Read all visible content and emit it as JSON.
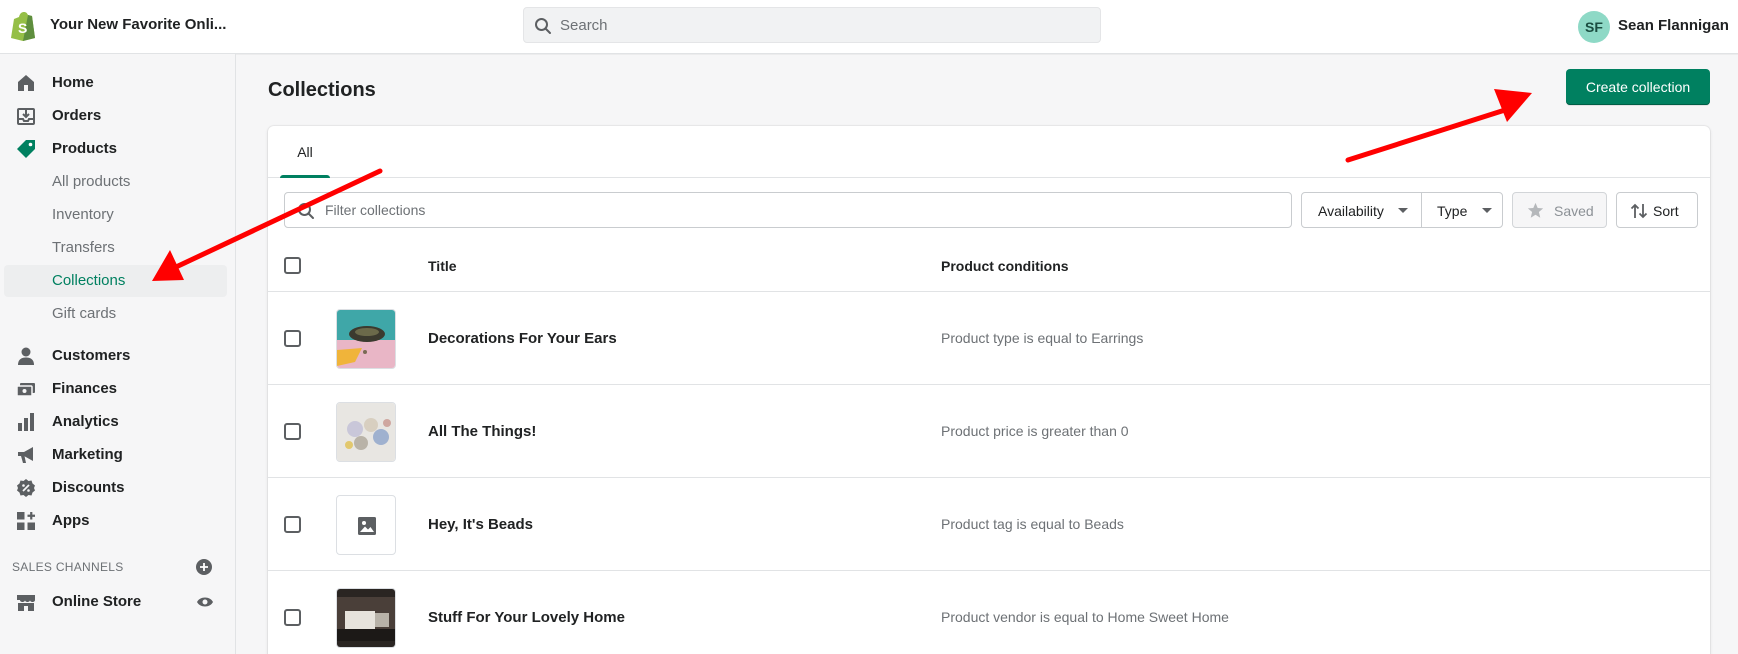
{
  "topbar": {
    "store_name": "Your New Favorite Onli...",
    "search_placeholder": "Search",
    "user_initials": "SF",
    "user_name": "Sean Flannigan"
  },
  "sidebar": {
    "items": [
      {
        "label": "Home",
        "icon": "home-icon"
      },
      {
        "label": "Orders",
        "icon": "orders-icon"
      },
      {
        "label": "Products",
        "icon": "tag-icon"
      },
      {
        "label": "All products"
      },
      {
        "label": "Inventory"
      },
      {
        "label": "Transfers"
      },
      {
        "label": "Collections",
        "active": true
      },
      {
        "label": "Gift cards"
      },
      {
        "label": "Customers",
        "icon": "person-icon"
      },
      {
        "label": "Finances",
        "icon": "finances-icon"
      },
      {
        "label": "Analytics",
        "icon": "bar-chart-icon"
      },
      {
        "label": "Marketing",
        "icon": "megaphone-icon"
      },
      {
        "label": "Discounts",
        "icon": "discount-icon"
      },
      {
        "label": "Apps",
        "icon": "apps-icon"
      }
    ],
    "sales_channels_heading": "SALES CHANNELS",
    "online_store_label": "Online Store"
  },
  "main": {
    "title": "Collections",
    "create_label": "Create collection",
    "tabs": [
      {
        "label": "All"
      }
    ],
    "filter_placeholder": "Filter collections",
    "filters": {
      "availability": "Availability",
      "type": "Type",
      "saved": "Saved",
      "sort": "Sort"
    },
    "columns": {
      "title": "Title",
      "conditions": "Product conditions"
    },
    "rows": [
      {
        "title": "Decorations For Your Ears",
        "condition": "Product type is equal to Earrings",
        "thumb": "earrings-photo"
      },
      {
        "title": "All The Things!",
        "condition": "Product price is greater than 0",
        "thumb": "items-photo"
      },
      {
        "title": "Hey, It's Beads",
        "condition": "Product tag is equal to Beads",
        "thumb": "image-placeholder-icon"
      },
      {
        "title": "Stuff For Your Lovely Home",
        "condition": "Product vendor is equal to Home Sweet Home",
        "thumb": "home-photo"
      }
    ]
  },
  "colors": {
    "accent": "#008060",
    "annotation_arrow": "#ff0000"
  }
}
